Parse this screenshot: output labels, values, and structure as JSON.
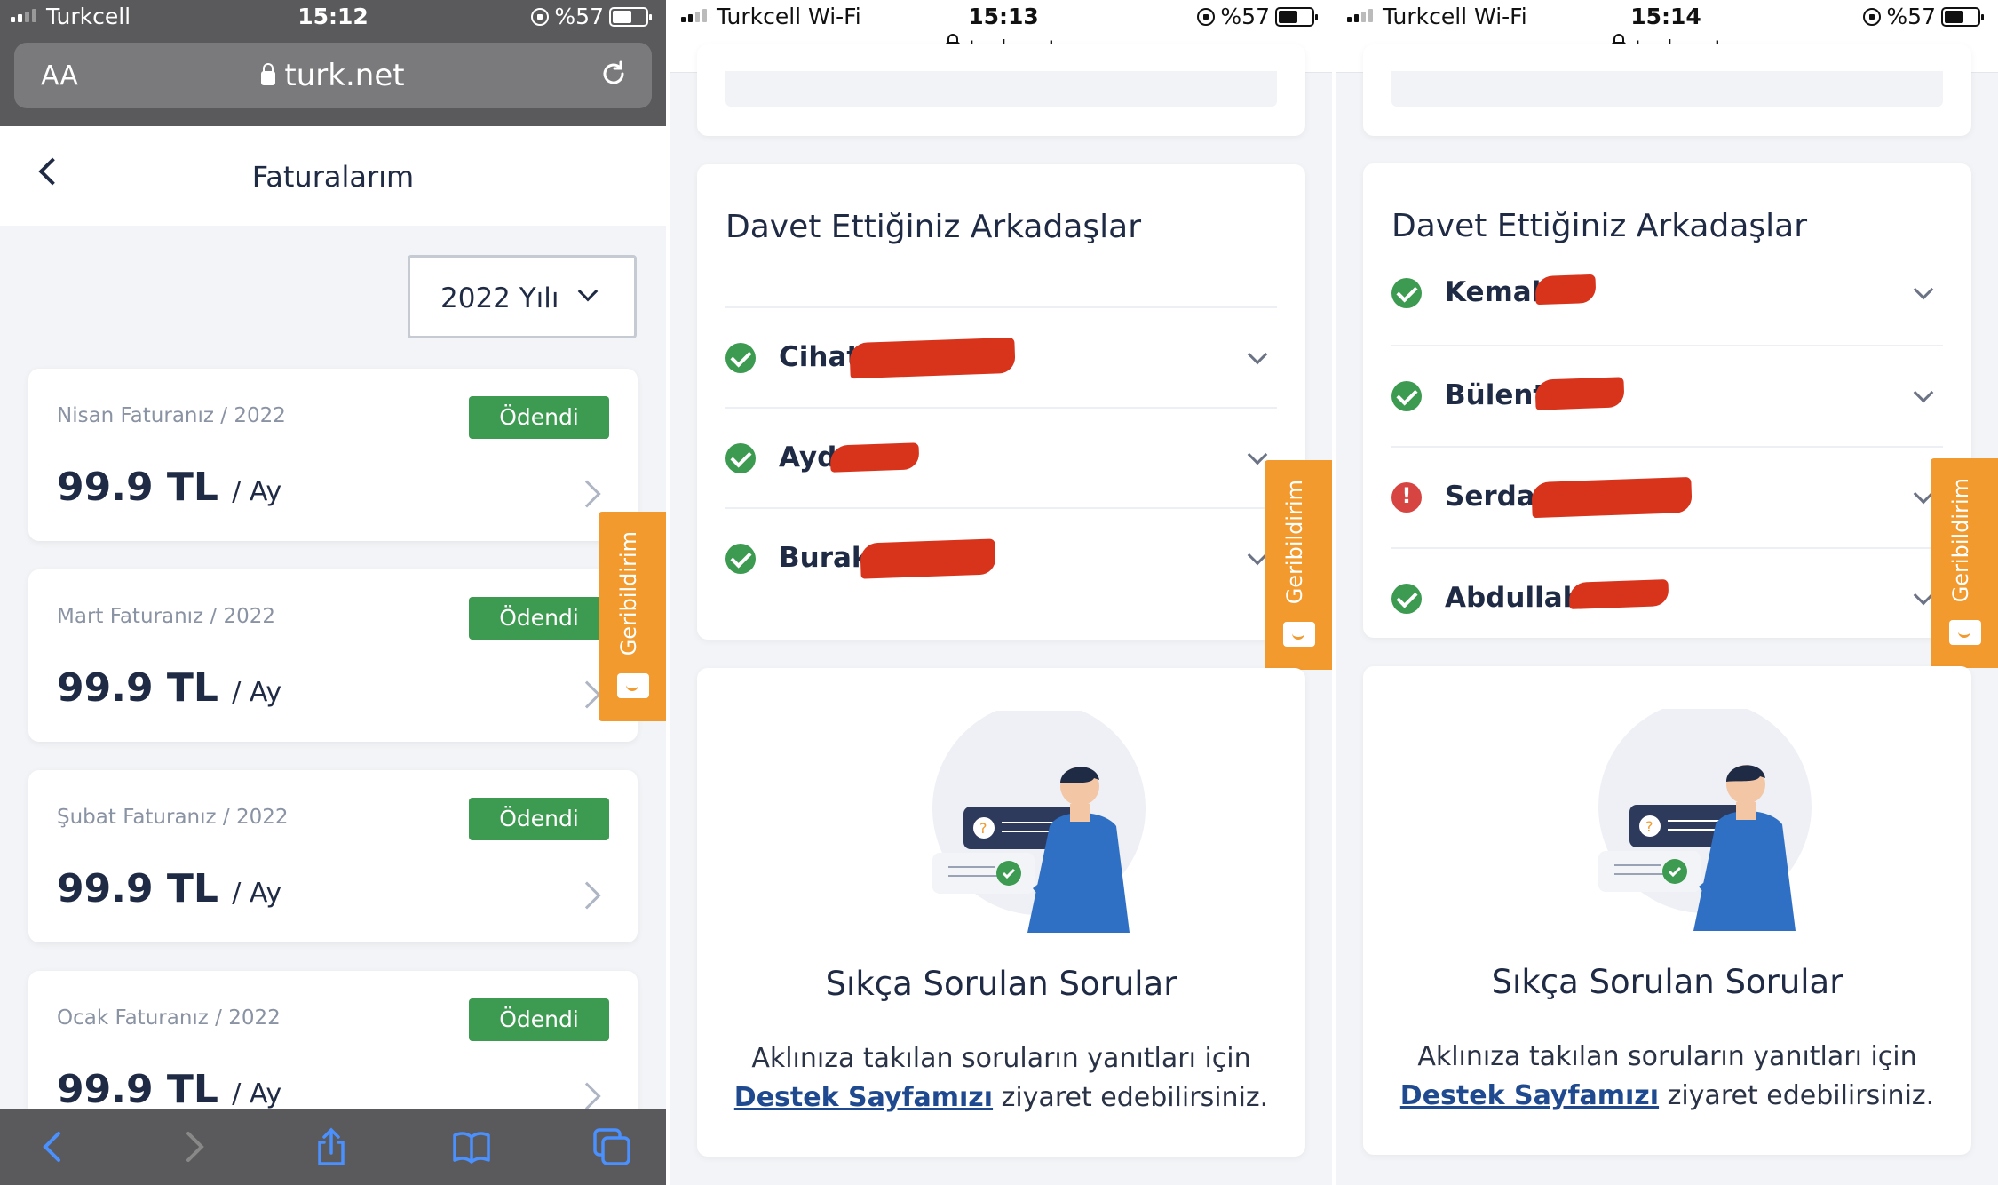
{
  "panel1": {
    "status": {
      "carrier": "Turkcell",
      "time": "15:12",
      "battery": "%57"
    },
    "browser": {
      "text_size": "AA",
      "url": "turk.net"
    },
    "nav": {
      "title": "Faturalarım"
    },
    "year_select": {
      "value": "2022 Yılı"
    },
    "invoices": [
      {
        "label": "Nisan Faturanız / 2022",
        "status": "Ödendi",
        "amount": "99.9 TL",
        "unit": "/ Ay"
      },
      {
        "label": "Mart Faturanız / 2022",
        "status": "Ödendi",
        "amount": "99.9 TL",
        "unit": "/ Ay"
      },
      {
        "label": "Şubat Faturanız / 2022",
        "status": "Ödendi",
        "amount": "99.9 TL",
        "unit": "/ Ay"
      },
      {
        "label": "Ocak Faturanız / 2022",
        "status": "Ödendi",
        "amount": "99.9 TL",
        "unit": "/ Ay"
      }
    ],
    "feedback": "Geribildirim"
  },
  "panel2": {
    "status": {
      "carrier": "Turkcell Wi-Fi",
      "time": "15:13",
      "battery": "%57",
      "url": "turk.net"
    },
    "friends_title": "Davet Ettiğiniz Arkadaşlar",
    "friends": [
      {
        "name": "Cihat",
        "status": "ok"
      },
      {
        "name": "Aydın",
        "status": "ok"
      },
      {
        "name": "Burak",
        "status": "ok"
      }
    ],
    "feedback": "Geribildirim",
    "faq": {
      "title": "Sıkça Sorulan Sorular",
      "line1": "Aklınıza takılan soruların yanıtları için",
      "link": "Destek Sayfamızı",
      "line2_rest": " ziyaret edebilirsiniz."
    }
  },
  "panel3": {
    "status": {
      "carrier": "Turkcell Wi-Fi",
      "time": "15:14",
      "battery": "%57",
      "url": "turk.net"
    },
    "friends_title": "Davet Ettiğiniz Arkadaşlar",
    "friends": [
      {
        "name": "Kemal",
        "status": "ok"
      },
      {
        "name": "Bülent",
        "status": "ok"
      },
      {
        "name": "Serdar",
        "status": "error"
      },
      {
        "name": "Abdullah",
        "status": "ok"
      }
    ],
    "feedback": "Geribildirim",
    "faq": {
      "title": "Sıkça Sorulan Sorular",
      "line1": "Aklınıza takılan soruların yanıtları için",
      "link": "Destek Sayfamızı",
      "line2_rest": " ziyaret edebilirsiniz."
    }
  },
  "colors": {
    "paid_badge": "#3c9b50",
    "feedback_tab": "#f29a2e",
    "error": "#d64541",
    "link": "#1f4a8f",
    "redaction": "#d8341c"
  }
}
